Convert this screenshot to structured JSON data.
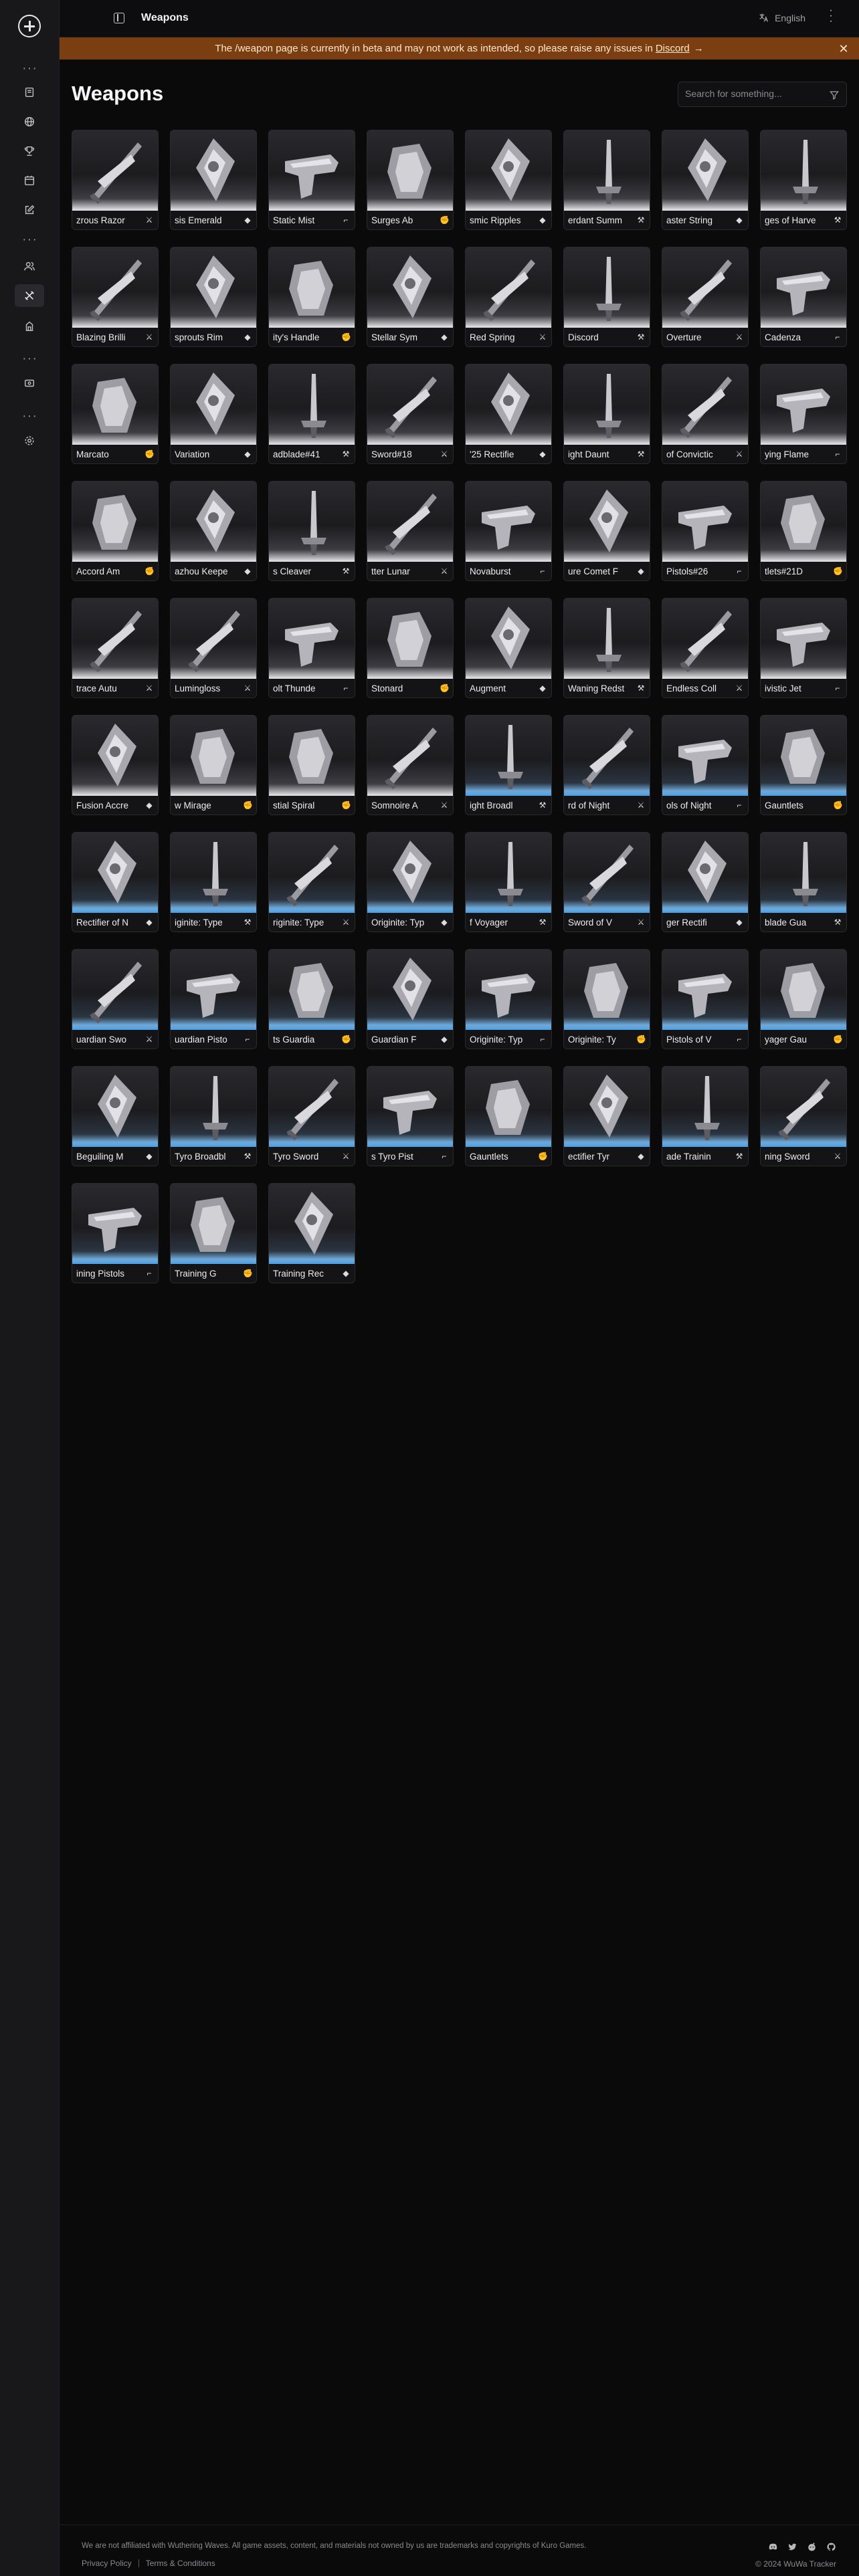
{
  "header": {
    "breadcrumb": "Weapons",
    "language": "English"
  },
  "banner": {
    "text_before": "The /weapon page is currently in beta and may not work as intended, so please raise any issues in",
    "link": "Discord",
    "arrow": "→",
    "close": "✕"
  },
  "page": {
    "title": "Weapons",
    "search_placeholder": "Search for something..."
  },
  "sidebar": {
    "dots": "···",
    "icons": [
      "book-icon",
      "globe-icon",
      "trophy-icon",
      "calendar-icon",
      "edit-icon",
      "users-icon",
      "sword-icon",
      "tower-icon",
      "ticket-icon",
      "settings-icon"
    ]
  },
  "weapons": [
    {
      "name": "zrous Razor",
      "type": "sword",
      "rarity": 5
    },
    {
      "name": "sis Emerald",
      "type": "rectifier",
      "rarity": 5
    },
    {
      "name": "Static Mist",
      "type": "pistols",
      "rarity": 5
    },
    {
      "name": "Surges Ab",
      "type": "gauntlets",
      "rarity": 5
    },
    {
      "name": "smic Ripples",
      "type": "rectifier",
      "rarity": 5
    },
    {
      "name": "erdant Summ",
      "type": "broadblade",
      "rarity": 5
    },
    {
      "name": "aster String",
      "type": "rectifier",
      "rarity": 5
    },
    {
      "name": "ges of Harve",
      "type": "broadblade",
      "rarity": 5
    },
    {
      "name": "Blazing Brilli",
      "type": "sword",
      "rarity": 5
    },
    {
      "name": "sprouts Rim",
      "type": "rectifier",
      "rarity": 5
    },
    {
      "name": "ity's Handle",
      "type": "gauntlets",
      "rarity": 5
    },
    {
      "name": "Stellar Sym",
      "type": "rectifier",
      "rarity": 5
    },
    {
      "name": "Red Spring",
      "type": "sword",
      "rarity": 5
    },
    {
      "name": "Discord",
      "type": "broadblade",
      "rarity": 4
    },
    {
      "name": "Overture",
      "type": "sword",
      "rarity": 4
    },
    {
      "name": "Cadenza",
      "type": "pistols",
      "rarity": 4
    },
    {
      "name": "Marcato",
      "type": "gauntlets",
      "rarity": 4
    },
    {
      "name": "Variation",
      "type": "rectifier",
      "rarity": 4
    },
    {
      "name": "adblade#41",
      "type": "broadblade",
      "rarity": 4
    },
    {
      "name": "Sword#18",
      "type": "sword",
      "rarity": 4
    },
    {
      "name": "'25 Rectifie",
      "type": "rectifier",
      "rarity": 4
    },
    {
      "name": "ight Daunt",
      "type": "broadblade",
      "rarity": 4
    },
    {
      "name": "of Convictic",
      "type": "sword",
      "rarity": 4
    },
    {
      "name": "ying Flame",
      "type": "pistols",
      "rarity": 4
    },
    {
      "name": "Accord Am",
      "type": "gauntlets",
      "rarity": 4
    },
    {
      "name": "azhou Keepe",
      "type": "rectifier",
      "rarity": 4
    },
    {
      "name": "s Cleaver",
      "type": "broadblade",
      "rarity": 4
    },
    {
      "name": "tter Lunar",
      "type": "sword",
      "rarity": 4
    },
    {
      "name": "Novaburst",
      "type": "pistols",
      "rarity": 4
    },
    {
      "name": "ure Comet F",
      "type": "rectifier",
      "rarity": 4
    },
    {
      "name": "Pistols#26",
      "type": "pistols",
      "rarity": 4
    },
    {
      "name": "tlets#21D",
      "type": "gauntlets",
      "rarity": 4
    },
    {
      "name": "trace Autu",
      "type": "sword",
      "rarity": 4
    },
    {
      "name": "Lumingloss",
      "type": "sword",
      "rarity": 4
    },
    {
      "name": "olt Thunde",
      "type": "pistols",
      "rarity": 4
    },
    {
      "name": "Stonard",
      "type": "gauntlets",
      "rarity": 4
    },
    {
      "name": "Augment",
      "type": "rectifier",
      "rarity": 4
    },
    {
      "name": "Waning Redst",
      "type": "broadblade",
      "rarity": 4
    },
    {
      "name": "Endless Coll",
      "type": "sword",
      "rarity": 4
    },
    {
      "name": "ivistic Jet",
      "type": "pistols",
      "rarity": 4
    },
    {
      "name": "Fusion Accre",
      "type": "rectifier",
      "rarity": 4
    },
    {
      "name": "w Mirage",
      "type": "gauntlets",
      "rarity": 4
    },
    {
      "name": "stial Spiral",
      "type": "gauntlets",
      "rarity": 4
    },
    {
      "name": "Somnoire A",
      "type": "sword",
      "rarity": 4
    },
    {
      "name": "ight Broadl",
      "type": "broadblade",
      "rarity": 3
    },
    {
      "name": "rd of Night",
      "type": "sword",
      "rarity": 3
    },
    {
      "name": "ols of Night",
      "type": "pistols",
      "rarity": 3
    },
    {
      "name": "Gauntlets",
      "type": "gauntlets",
      "rarity": 3
    },
    {
      "name": "Rectifier of N",
      "type": "rectifier",
      "rarity": 3
    },
    {
      "name": "iginite: Type",
      "type": "broadblade",
      "rarity": 3
    },
    {
      "name": "riginite: Type",
      "type": "sword",
      "rarity": 3
    },
    {
      "name": "Originite: Typ",
      "type": "rectifier",
      "rarity": 3
    },
    {
      "name": "f Voyager",
      "type": "broadblade",
      "rarity": 3
    },
    {
      "name": "Sword of V",
      "type": "sword",
      "rarity": 3
    },
    {
      "name": "ger Rectifi",
      "type": "rectifier",
      "rarity": 3
    },
    {
      "name": "blade Gua",
      "type": "broadblade",
      "rarity": 3
    },
    {
      "name": "uardian Swo",
      "type": "sword",
      "rarity": 3
    },
    {
      "name": "uardian Pisto",
      "type": "pistols",
      "rarity": 3
    },
    {
      "name": "ts Guardia",
      "type": "gauntlets",
      "rarity": 3
    },
    {
      "name": "Guardian F",
      "type": "rectifier",
      "rarity": 3
    },
    {
      "name": "Originite: Typ",
      "type": "pistols",
      "rarity": 3
    },
    {
      "name": "Originite: Ty",
      "type": "gauntlets",
      "rarity": 3
    },
    {
      "name": "Pistols of V",
      "type": "pistols",
      "rarity": 3
    },
    {
      "name": "yager Gau",
      "type": "gauntlets",
      "rarity": 3
    },
    {
      "name": "Beguiling M",
      "type": "rectifier",
      "rarity": 3
    },
    {
      "name": "Tyro Broadbl",
      "type": "broadblade",
      "rarity": 2
    },
    {
      "name": "Tyro Sword",
      "type": "sword",
      "rarity": 2
    },
    {
      "name": "s Tyro Pist",
      "type": "pistols",
      "rarity": 2
    },
    {
      "name": "Gauntlets",
      "type": "gauntlets",
      "rarity": 2
    },
    {
      "name": "ectifier Tyr",
      "type": "rectifier",
      "rarity": 2
    },
    {
      "name": "ade Trainin",
      "type": "broadblade",
      "rarity": 1
    },
    {
      "name": "ning Sword",
      "type": "sword",
      "rarity": 1
    },
    {
      "name": "ining Pistols",
      "type": "pistols",
      "rarity": 1
    },
    {
      "name": "Training G",
      "type": "gauntlets",
      "rarity": 1
    },
    {
      "name": "Training Rec",
      "type": "rectifier",
      "rarity": 1
    }
  ],
  "footer": {
    "disclaimer": "We are not affiliated with Wuthering Waves. All game assets, content, and materials not owned by us are trademarks and copyrights of Kuro Games.",
    "privacy": "Privacy Policy",
    "terms": "Terms & Conditions",
    "copyright": "© 2024 WuWa Tracker",
    "socials": [
      "discord-icon",
      "twitter-icon",
      "reddit-icon",
      "github-icon"
    ]
  },
  "colors": {
    "accent_banner": "#7a3e10",
    "rarity_blue": "#4fa3e8",
    "background": "#0a0a0b"
  }
}
